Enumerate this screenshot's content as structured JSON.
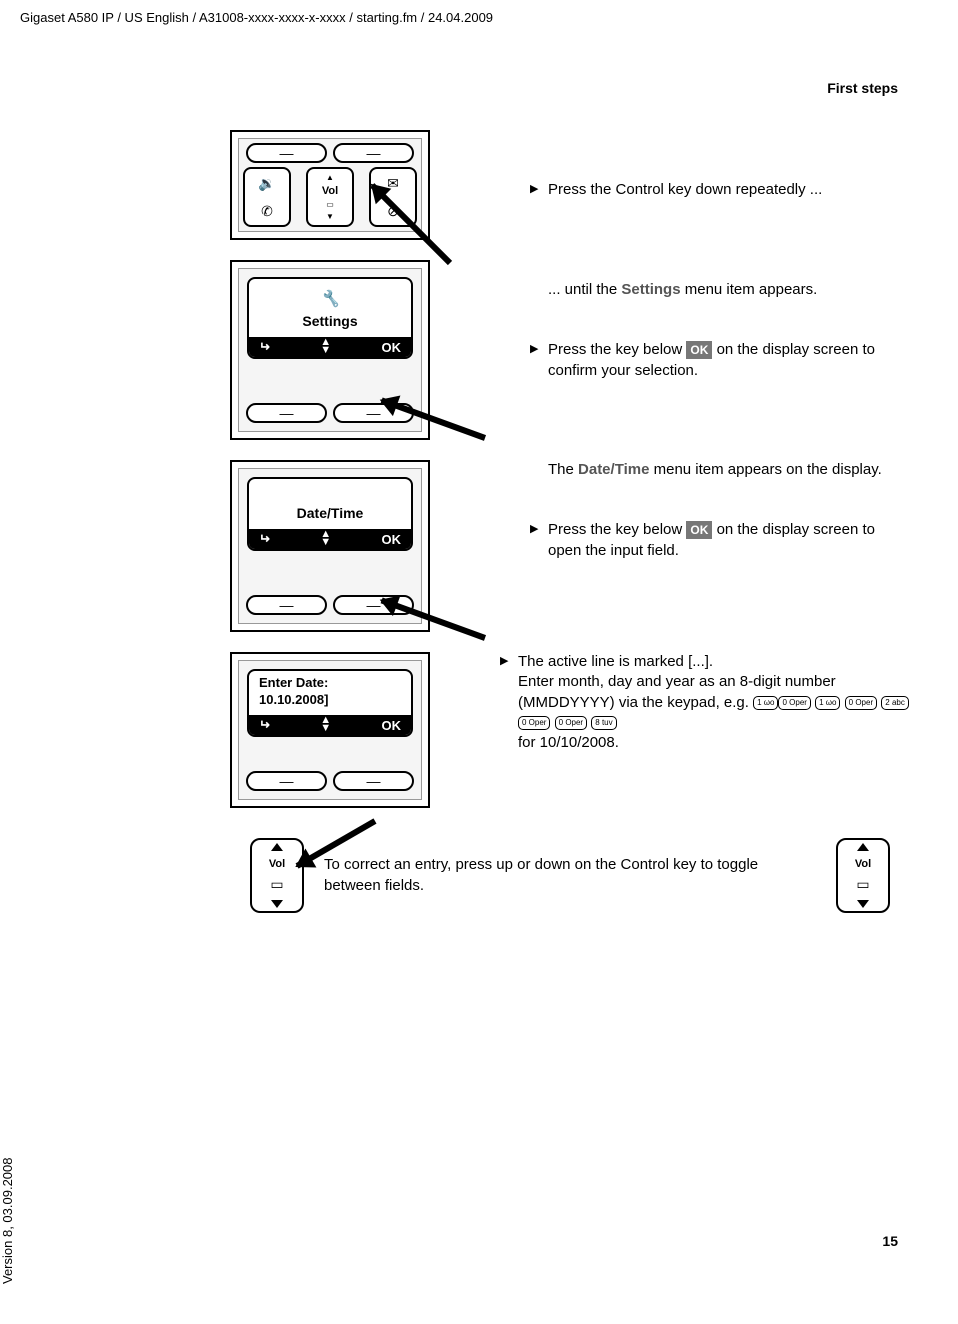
{
  "header": "Gigaset A580 IP / US English / A31008-xxxx-xxxx-x-xxxx / starting.fm / 24.04.2009",
  "section_title": "First steps",
  "page_number": "15",
  "version": "Version 8, 03.09.2008",
  "screens": {
    "settings_label": "Settings",
    "datetime_label": "Date/Time",
    "enter_date_label": "Enter Date:",
    "enter_date_value": "10.10.2008]",
    "ok_label": "OK",
    "vol_label": "Vol"
  },
  "instructions": {
    "step1": "Press the Control key down repeatedly ...",
    "step2a": "... until the ",
    "step2b": "Settings",
    "step2c": " menu item appears.",
    "step3a": "Press the key below ",
    "step3b": " on the display screen to confirm your selection.",
    "step4a": "The ",
    "step4b": "Date/Time",
    "step4c": " menu item appears on the display.",
    "step5a": "Press the key below ",
    "step5b": " on the display screen to open the input field.",
    "step6a": "The active line is marked [...].",
    "step6b": "Enter month, day and year as an 8-digit number (MMDDYYYY) via the keypad, e.g. ",
    "step6c": "for 10/10/2008.",
    "bottom": "To correct an entry, press up or down on the Control key to toggle between fields."
  },
  "ok_badge": "OK",
  "keys": {
    "k1": "1 ωο",
    "k0": "0 Oper",
    "k2": "2 abc",
    "k8": "8 tuv"
  }
}
